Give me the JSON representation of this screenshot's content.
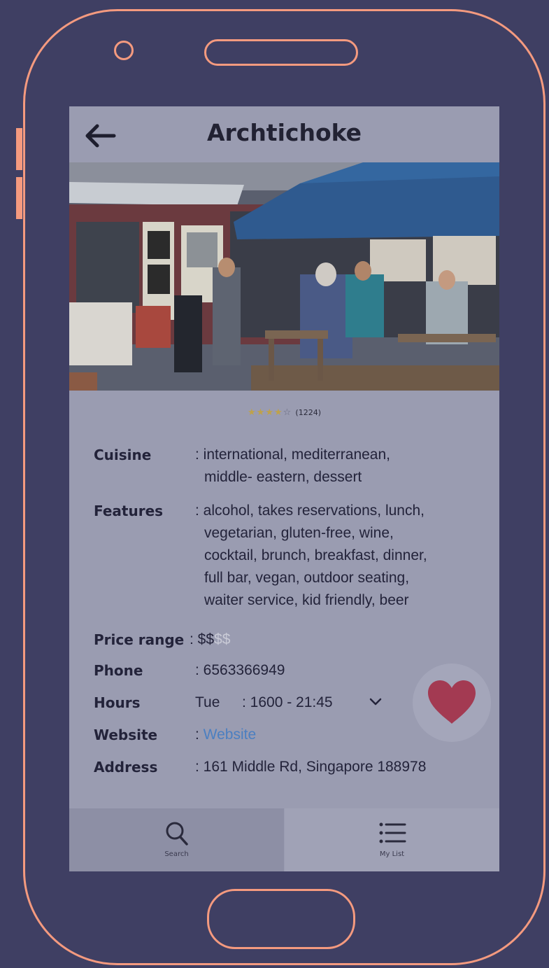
{
  "header": {
    "title": "Archtichoke"
  },
  "rating": {
    "stars_filled": 4,
    "stars_total": 5,
    "count": "(1224)"
  },
  "details": {
    "cuisine": {
      "label": "Cuisine",
      "lines": [
        ": international, mediterranean,",
        "middle- eastern, dessert"
      ]
    },
    "features": {
      "label": "Features",
      "lines": [
        ": alcohol, takes reservations, lunch,",
        "vegetarian, gluten-free, wine,",
        "cocktail, brunch, breakfast, dinner,",
        "full bar, vegan, outdoor seating,",
        "waiter service, kid friendly, beer"
      ]
    },
    "price": {
      "label": "Price range",
      "prefix": ": ",
      "active": "$$",
      "inactive": "$$"
    },
    "phone": {
      "label": "Phone",
      "value": ": 6563366949"
    },
    "hours": {
      "label": "Hours",
      "day": "Tue",
      "time": ": 1600 - 21:45"
    },
    "website": {
      "label": "Website",
      "prefix": ": ",
      "link": "Website"
    },
    "address": {
      "label": "Address",
      "value": ": 161 Middle Rd, Singapore 188978"
    }
  },
  "tabs": [
    {
      "label": "Search",
      "icon": "search-icon"
    },
    {
      "label": "My List",
      "icon": "list-icon"
    }
  ],
  "colors": {
    "accent": "#f49a7f",
    "heart": "#a33a52",
    "link": "#4b7fc1",
    "background": "#3f3f63"
  }
}
